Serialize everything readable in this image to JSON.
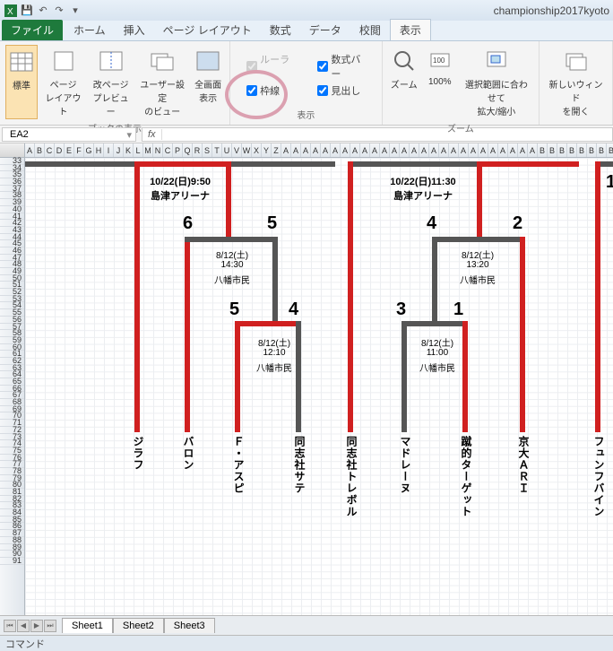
{
  "title": "championship2017kyoto",
  "tabs": {
    "file": "ファイル",
    "home": "ホーム",
    "insert": "挿入",
    "pagelayout": "ページ レイアウト",
    "formulas": "数式",
    "data": "データ",
    "review": "校閲",
    "view": "表示"
  },
  "ribbon": {
    "workbook_views": {
      "label": "ブックの表示",
      "normal": "標準",
      "page_layout": "ページ\nレイアウト",
      "page_break": "改ページ\nプレビュー",
      "custom": "ユーザー設定\nのビュー",
      "full": "全画面\n表示"
    },
    "show": {
      "label": "表示",
      "ruler": "ルーラー",
      "formula_bar": "数式バー",
      "gridlines": "枠線",
      "headings": "見出し"
    },
    "zoom": {
      "label": "ズーム",
      "zoom": "ズーム",
      "hundred": "100%",
      "sel": "選択範囲に合わせて\n拡大/縮小"
    },
    "window": {
      "new": "新しいウィンド\nを開く"
    }
  },
  "namebox": "EA2",
  "colheads": [
    "A",
    "B",
    "C",
    "D",
    "E",
    "F",
    "G",
    "H",
    "I",
    "J",
    "K",
    "L",
    "M",
    "N",
    "C",
    "P",
    "Q",
    "R",
    "S",
    "T",
    "U",
    "V",
    "W",
    "X",
    "Y",
    "Z",
    "A",
    "A",
    "A",
    "A",
    "A",
    "A",
    "A",
    "A",
    "A",
    "A",
    "A",
    "A",
    "A",
    "A",
    "A",
    "A",
    "A",
    "A",
    "A",
    "A",
    "A",
    "A",
    "A",
    "A",
    "A",
    "A",
    "B",
    "B",
    "B",
    "B",
    "B",
    "B",
    "B",
    "B",
    "B"
  ],
  "rowstart": 33,
  "rowcount": 59,
  "bracket": {
    "top1": {
      "date": "10/22(日)9:50",
      "venue": "島津アリーナ"
    },
    "top2": {
      "date": "10/22(日)11:30",
      "venue": "島津アリーナ"
    },
    "seed_l1": "6",
    "seed_r1": "5",
    "seed_l2": "4",
    "seed_r2": "2",
    "mid1": {
      "date": "8/12(土)",
      "time": "14:30",
      "venue": "八幡市民"
    },
    "mid2": {
      "date": "8/12(土)",
      "time": "13:20",
      "venue": "八幡市民"
    },
    "seed_bl1": "5",
    "seed_br1": "4",
    "seed_bl2": "3",
    "seed_br2": "1",
    "bot1": {
      "date": "8/12(土)",
      "time": "12:10",
      "venue": "八幡市民"
    },
    "bot2": {
      "date": "8/12(土)",
      "time": "11:00",
      "venue": "八幡市民"
    },
    "teams": [
      "ジラフ",
      "バロン",
      "Ｆ・アスピ",
      "同志社サテ",
      "同志社トレボル",
      "マドレーヌ",
      "蹴的ターゲット",
      "京大ＡＲＩ",
      "フュンフバイン"
    ],
    "rt": "1"
  },
  "sheets": [
    "Sheet1",
    "Sheet2",
    "Sheet3"
  ],
  "status": "コマンド"
}
